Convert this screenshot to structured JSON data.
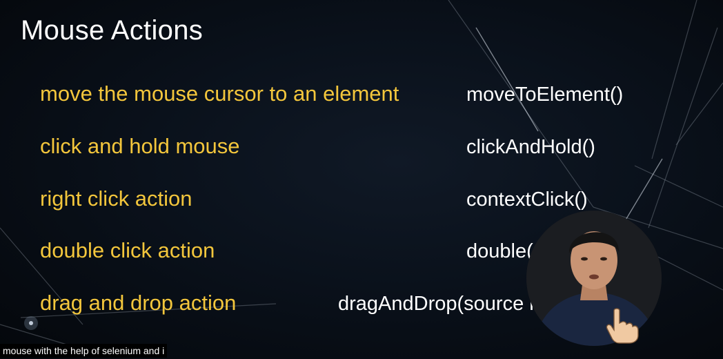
{
  "slide": {
    "title": "Mouse Actions",
    "actions": [
      {
        "description": "move the mouse cursor to an element",
        "method": "moveToElement()"
      },
      {
        "description": "click and hold mouse",
        "method": "clickAndHold()"
      },
      {
        "description": "right click action",
        "method": "contextClick()"
      },
      {
        "description": "double click action",
        "method": "double("
      },
      {
        "description": "drag and drop action",
        "method": "dragAndDrop(source            ne)"
      }
    ]
  },
  "caption": {
    "text": "mouse with the help of selenium and i"
  },
  "colors": {
    "background": "#0a111b",
    "title": "#ffffff",
    "description": "#f3c63c",
    "method": "#ffffff",
    "caption_bg": "#000000"
  },
  "webcam": {
    "icon": "presenter-webcam-overlay",
    "hand_icon": "pointing-hand-icon"
  }
}
